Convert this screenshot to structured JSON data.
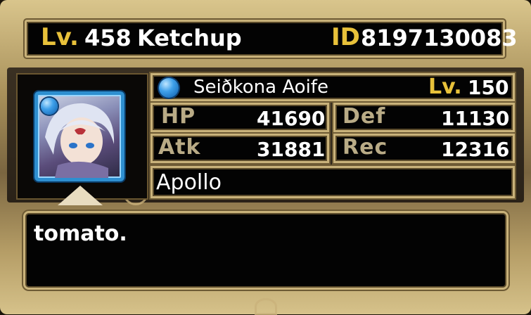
{
  "header": {
    "level_label": "Lv.",
    "level_value": "458",
    "player_name": "Ketchup",
    "id_label": "ID",
    "id_value": "8197130083"
  },
  "leader": {
    "element_icon": "water-orb-icon",
    "name": "Seiðkona Aoife",
    "level_label": "Lv.",
    "level_value": "150",
    "stats": {
      "hp_label": "HP",
      "hp_value": "41690",
      "def_label": "Def",
      "def_value": "11130",
      "atk_label": "Atk",
      "atk_value": "31881",
      "rec_label": "Rec",
      "rec_value": "12316"
    }
  },
  "guild": {
    "name": "Apollo"
  },
  "message": {
    "text": "tomato."
  },
  "colors": {
    "gold_text": "#e8c13a",
    "frame_gold": "#c9b27a",
    "panel_black": "#030303",
    "water_blue": "#2e8fd0"
  }
}
